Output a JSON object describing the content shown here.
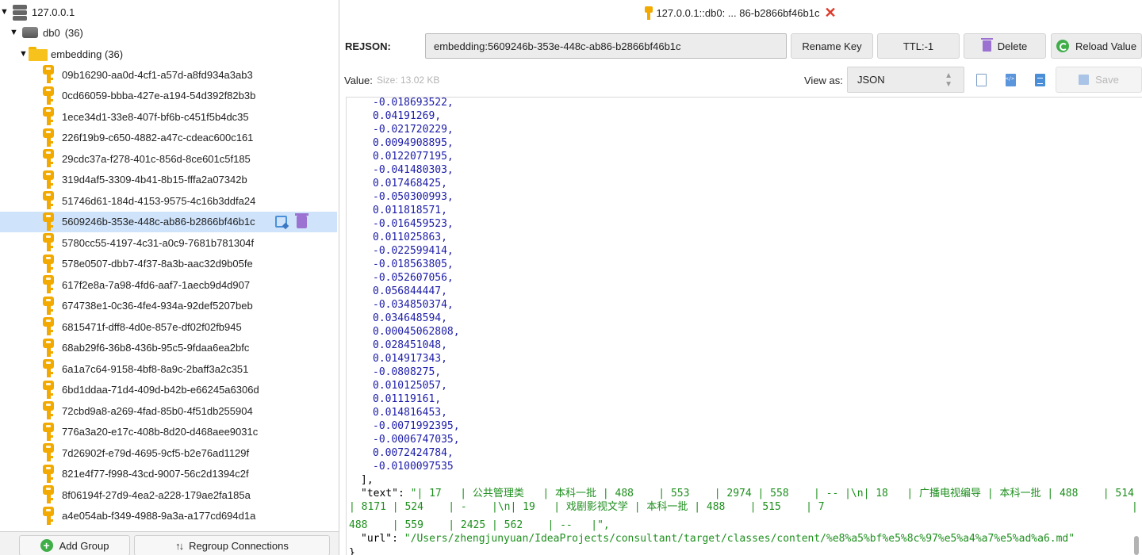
{
  "tree": {
    "server": {
      "label": "127.0.0.1"
    },
    "database": {
      "label": "db0",
      "count": "(36)"
    },
    "namespace": {
      "label": "embedding (36)"
    },
    "keys": [
      "09b16290-aa0d-4cf1-a57d-a8fd934a3ab3",
      "0cd66059-bbba-427e-a194-54d392f82b3b",
      "1ece34d1-33e8-407f-bf6b-c451f5b4dc35",
      "226f19b9-c650-4882-a47c-cdeac600c161",
      "29cdc37a-f278-401c-856d-8ce601c5f185",
      "319d4af5-3309-4b41-8b15-fffa2a07342b",
      "51746d61-184d-4153-9575-4c16b3ddfa24",
      "5609246b-353e-448c-ab86-b2866bf46b1c",
      "5780cc55-4197-4c31-a0c9-7681b781304f",
      "578e0507-dbb7-4f37-8a3b-aac32d9b05fe",
      "617f2e8a-7a98-4fd6-aaf7-1aecb9d4d907",
      "674738e1-0c36-4fe4-934a-92def5207beb",
      "6815471f-dff8-4d0e-857e-df02f02fb945",
      "68ab29f6-36b8-436b-95c5-9fdaa6ea2bfc",
      "6a1a7c64-9158-4bf8-8a9c-2baff3a2c351",
      "6bd1ddaa-71d4-409d-b42b-e66245a6306d",
      "72cbd9a8-a269-4fad-85b0-4f51db255904",
      "776a3a20-e17c-408b-8d20-d468aee9031c",
      "7d26902f-e79d-4695-9cf5-b2e76ad1129f",
      "821e4f77-f998-43cd-9007-56c2d1394c2f",
      "8f06194f-27d9-4ea2-a228-179ae2fa185a",
      "a4e054ab-f349-4988-9a3a-a177cd694d1a"
    ],
    "selected_index": 7,
    "footer": {
      "add_group": "Add Group",
      "regroup": "Regroup Connections"
    }
  },
  "tab": {
    "title": "127.0.0.1::db0: ... 86-b2866bf46b1c"
  },
  "keybar": {
    "type_label": "REJSON:",
    "key_name": "embedding:5609246b-353e-448c-ab86-b2866bf46b1c",
    "rename": "Rename Key",
    "ttl": "TTL:-1",
    "delete": "Delete",
    "reload": "Reload Value"
  },
  "valuebar": {
    "value_label": "Value:",
    "size": "Size: 13.02 KB",
    "view_as_label": "View as:",
    "view_as_value": "JSON",
    "save": "Save"
  },
  "editor": {
    "numbers": [
      "-0.018693522,",
      "0.04191269,",
      "-0.021720229,",
      "0.0094908895,",
      "0.0122077195,",
      "-0.041480303,",
      "0.017468425,",
      "-0.050300993,",
      "0.011818571,",
      "-0.016459523,",
      "0.011025863,",
      "-0.022599414,",
      "-0.018563805,",
      "-0.052607056,",
      "0.056844447,",
      "-0.034850374,",
      "0.034648594,",
      "0.00045062808,",
      "0.028451048,",
      "0.014917343,",
      "-0.0808275,",
      "0.010125057,",
      "0.01119161,",
      "0.014816453,",
      "-0.0071992395,",
      "-0.0006747035,",
      "0.0072424784,",
      "-0.0100097535"
    ],
    "bracket_close": "],",
    "text_key": "\"text\": ",
    "text_line1": "\"| 17   | 公共管理类   | 本科一批 | 488    | 553    | 2974 | 558    | -- |\\n| 18   | 广播电视编导 | 本科一批 | 488    | 514",
    "text_line2": "| 8171 | 524    | -    |\\n| 19   | 戏剧影视文学 | 本科一批 | 488    | 515    | 792",
    "text_line2_end": "|",
    "text_line3": "488    | 559    | 2425 | 562    | --   |\",",
    "url_key": "\"url\": ",
    "url_value": "\"/Users/zhengjunyuan/IdeaProjects/consultant/target/classes/content/%e8%a5%bf%e5%8c%97%e5%a4%a7%e5%ad%a6.md\"",
    "brace_close": "}"
  }
}
